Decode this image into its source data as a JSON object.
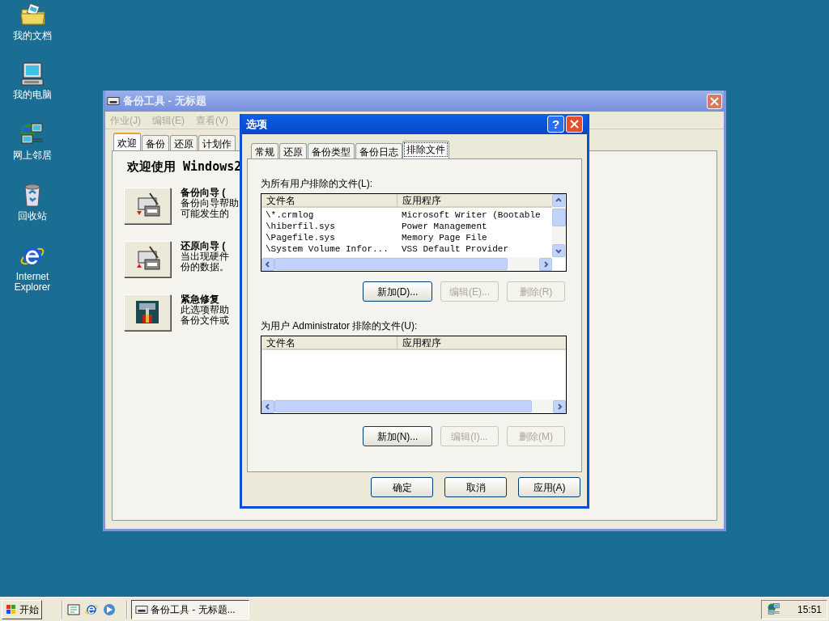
{
  "desktop_icons": [
    {
      "kind": "documents",
      "label": "我的文档"
    },
    {
      "kind": "computer",
      "label": "我的电脑"
    },
    {
      "kind": "network",
      "label": "网上邻居"
    },
    {
      "kind": "recycle",
      "label": "回收站"
    },
    {
      "kind": "browser",
      "label": "Internet Explorer"
    }
  ],
  "main_window": {
    "title": "备份工具 - 无标题",
    "menu": [
      {
        "label": "作业(J)",
        "disabled": true
      },
      {
        "label": "编辑(E)",
        "disabled": true
      },
      {
        "label": "查看(V)",
        "disabled": true
      }
    ],
    "tabs": [
      {
        "label": "欢迎",
        "selected": true
      },
      {
        "label": "备份",
        "selected": false
      },
      {
        "label": "还原",
        "selected": false
      },
      {
        "label": "计划作",
        "selected": false
      }
    ],
    "heading": "欢迎使用 Windows2",
    "wizards": [
      {
        "kind": "backup",
        "title": "备份向导 (",
        "lines": [
          "备份向导帮助",
          "可能发生的"
        ]
      },
      {
        "kind": "restore",
        "title": "还原向导 (",
        "lines": [
          "当出现硬件",
          "份的数据。"
        ]
      },
      {
        "kind": "repair",
        "title": "紧急修复",
        "lines": [
          "此选项帮助",
          "备份文件或"
        ]
      }
    ]
  },
  "dialog": {
    "title": "选项",
    "help_button": "?",
    "tabs": [
      {
        "label": "常规",
        "selected": false
      },
      {
        "label": "还原",
        "selected": false
      },
      {
        "label": "备份类型",
        "selected": false
      },
      {
        "label": "备份日志",
        "selected": false
      },
      {
        "label": "排除文件",
        "selected": true
      }
    ],
    "sections": [
      {
        "label": "为所有用户排除的文件(L):",
        "columns": [
          "文件名",
          "应用程序"
        ],
        "rows": [
          [
            "\\*.crmlog",
            "Microsoft Writer (Bootable"
          ],
          [
            "\\hiberfil.sys",
            "Power Management"
          ],
          [
            "\\Pagefile.sys",
            "Memory Page File"
          ],
          [
            "\\System Volume Infor...",
            "VSS Default Provider"
          ]
        ],
        "buttons": [
          {
            "label": "新加(D)...",
            "disabled": false
          },
          {
            "label": "编辑(E)...",
            "disabled": true
          },
          {
            "label": "删除(R)",
            "disabled": true
          }
        ]
      },
      {
        "label": "为用户 Administrator 排除的文件(U):",
        "columns": [
          "文件名",
          "应用程序"
        ],
        "buttons": [
          {
            "label": "新加(N)...",
            "disabled": false
          },
          {
            "label": "编辑(I)...",
            "disabled": true
          },
          {
            "label": "删除(M)",
            "disabled": true
          }
        ]
      }
    ],
    "buttons": [
      "确定",
      "取消",
      "应用(A)"
    ]
  },
  "taskbar": {
    "start": "开始",
    "quick_launch": [
      {
        "kind": "desktop"
      },
      {
        "kind": "browser"
      },
      {
        "kind": "media"
      }
    ],
    "tasks": [
      {
        "label": "备份工具 - 无标题..."
      }
    ],
    "clock": "15:51"
  }
}
